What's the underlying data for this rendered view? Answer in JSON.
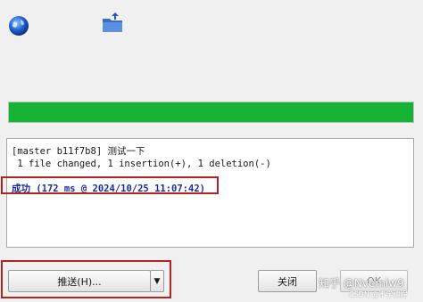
{
  "output": {
    "commit_line": "[master b11f7b8] 测试一下",
    "stats_line": " 1 file changed, 1 insertion(+), 1 deletion(-)",
    "status_line": "成功 (172 ms @ 2024/10/25 11:07:42)"
  },
  "progress": {
    "value_percent": 100,
    "color": "#14b334"
  },
  "buttons": {
    "push_label": "推送(H)...",
    "push_dropdown_label": "▼",
    "close_label": "关闭",
    "ok_label": "OK"
  },
  "icons": {
    "top_left": "globe-icon",
    "top_middle": "folder-icon"
  },
  "watermark": {
    "main": "知乎 @Nvemiw9",
    "sub": "CSDN @不学编程"
  },
  "highlight_color": "#b42323"
}
